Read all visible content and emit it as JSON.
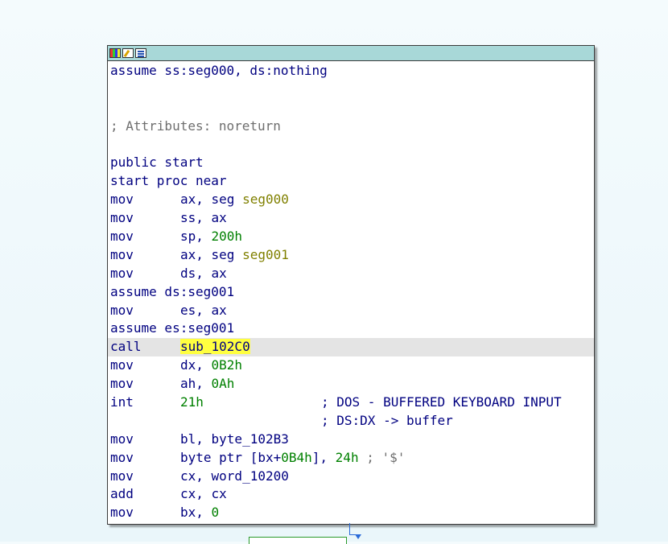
{
  "node": {
    "title_icons": [
      "color-icon",
      "edit-icon",
      "graph-icon"
    ],
    "lines": [
      {
        "type": "directive",
        "text": "assume ss:seg000, ds:nothing"
      },
      {
        "type": "blank"
      },
      {
        "type": "blank"
      },
      {
        "type": "comment",
        "text": "; Attributes: noreturn"
      },
      {
        "type": "blank"
      },
      {
        "type": "directive",
        "text": "public start"
      },
      {
        "type": "directive",
        "text": "start proc near"
      },
      {
        "type": "insn",
        "mnem": "mov",
        "parts": [
          {
            "t": "ax, seg ",
            "c": "ops"
          },
          {
            "t": "seg000",
            "c": "seg"
          }
        ]
      },
      {
        "type": "insn",
        "mnem": "mov",
        "parts": [
          {
            "t": "ss, ax",
            "c": "ops"
          }
        ]
      },
      {
        "type": "insn",
        "mnem": "mov",
        "parts": [
          {
            "t": "sp, ",
            "c": "ops"
          },
          {
            "t": "200h",
            "c": "num"
          }
        ]
      },
      {
        "type": "insn",
        "mnem": "mov",
        "parts": [
          {
            "t": "ax, seg ",
            "c": "ops"
          },
          {
            "t": "seg001",
            "c": "seg"
          }
        ]
      },
      {
        "type": "insn",
        "mnem": "mov",
        "parts": [
          {
            "t": "ds, ax",
            "c": "ops"
          }
        ]
      },
      {
        "type": "directive",
        "text": "assume ds:seg001"
      },
      {
        "type": "insn",
        "mnem": "mov",
        "parts": [
          {
            "t": "es, ax",
            "c": "ops"
          }
        ]
      },
      {
        "type": "directive",
        "text": "assume es:seg001"
      },
      {
        "type": "insn",
        "mnem": "call",
        "highlight": true,
        "parts": [
          {
            "t": "sub_102C0",
            "c": "sel"
          }
        ]
      },
      {
        "type": "insn",
        "mnem": "mov",
        "parts": [
          {
            "t": "dx, ",
            "c": "ops"
          },
          {
            "t": "0B2h",
            "c": "num"
          }
        ]
      },
      {
        "type": "insn",
        "mnem": "mov",
        "parts": [
          {
            "t": "ah, ",
            "c": "ops"
          },
          {
            "t": "0Ah",
            "c": "num"
          }
        ]
      },
      {
        "type": "insn",
        "mnem": "int",
        "wrap": true,
        "parts": [
          {
            "t": "21h",
            "c": "num"
          }
        ],
        "comment": "; DOS - BUFFERED KEYBOARD INPUT"
      },
      {
        "type": "cont",
        "comment": "; DS:DX -> buffer"
      },
      {
        "type": "insn",
        "mnem": "mov",
        "parts": [
          {
            "t": "bl, byte_102B3",
            "c": "ops"
          }
        ]
      },
      {
        "type": "insn",
        "mnem": "mov",
        "parts": [
          {
            "t": "byte ptr [bx+",
            "c": "ops"
          },
          {
            "t": "0B4h",
            "c": "num"
          },
          {
            "t": "], ",
            "c": "ops"
          },
          {
            "t": "24h",
            "c": "num"
          },
          {
            "t": " ; '$'",
            "c": "cmt"
          }
        ]
      },
      {
        "type": "insn",
        "mnem": "mov",
        "parts": [
          {
            "t": "cx, word_10200",
            "c": "ops"
          }
        ]
      },
      {
        "type": "insn",
        "mnem": "add",
        "parts": [
          {
            "t": "cx, cx",
            "c": "ops"
          }
        ]
      },
      {
        "type": "insn",
        "mnem": "mov",
        "parts": [
          {
            "t": "bx, ",
            "c": "ops"
          },
          {
            "t": "0",
            "c": "num"
          }
        ]
      }
    ]
  }
}
